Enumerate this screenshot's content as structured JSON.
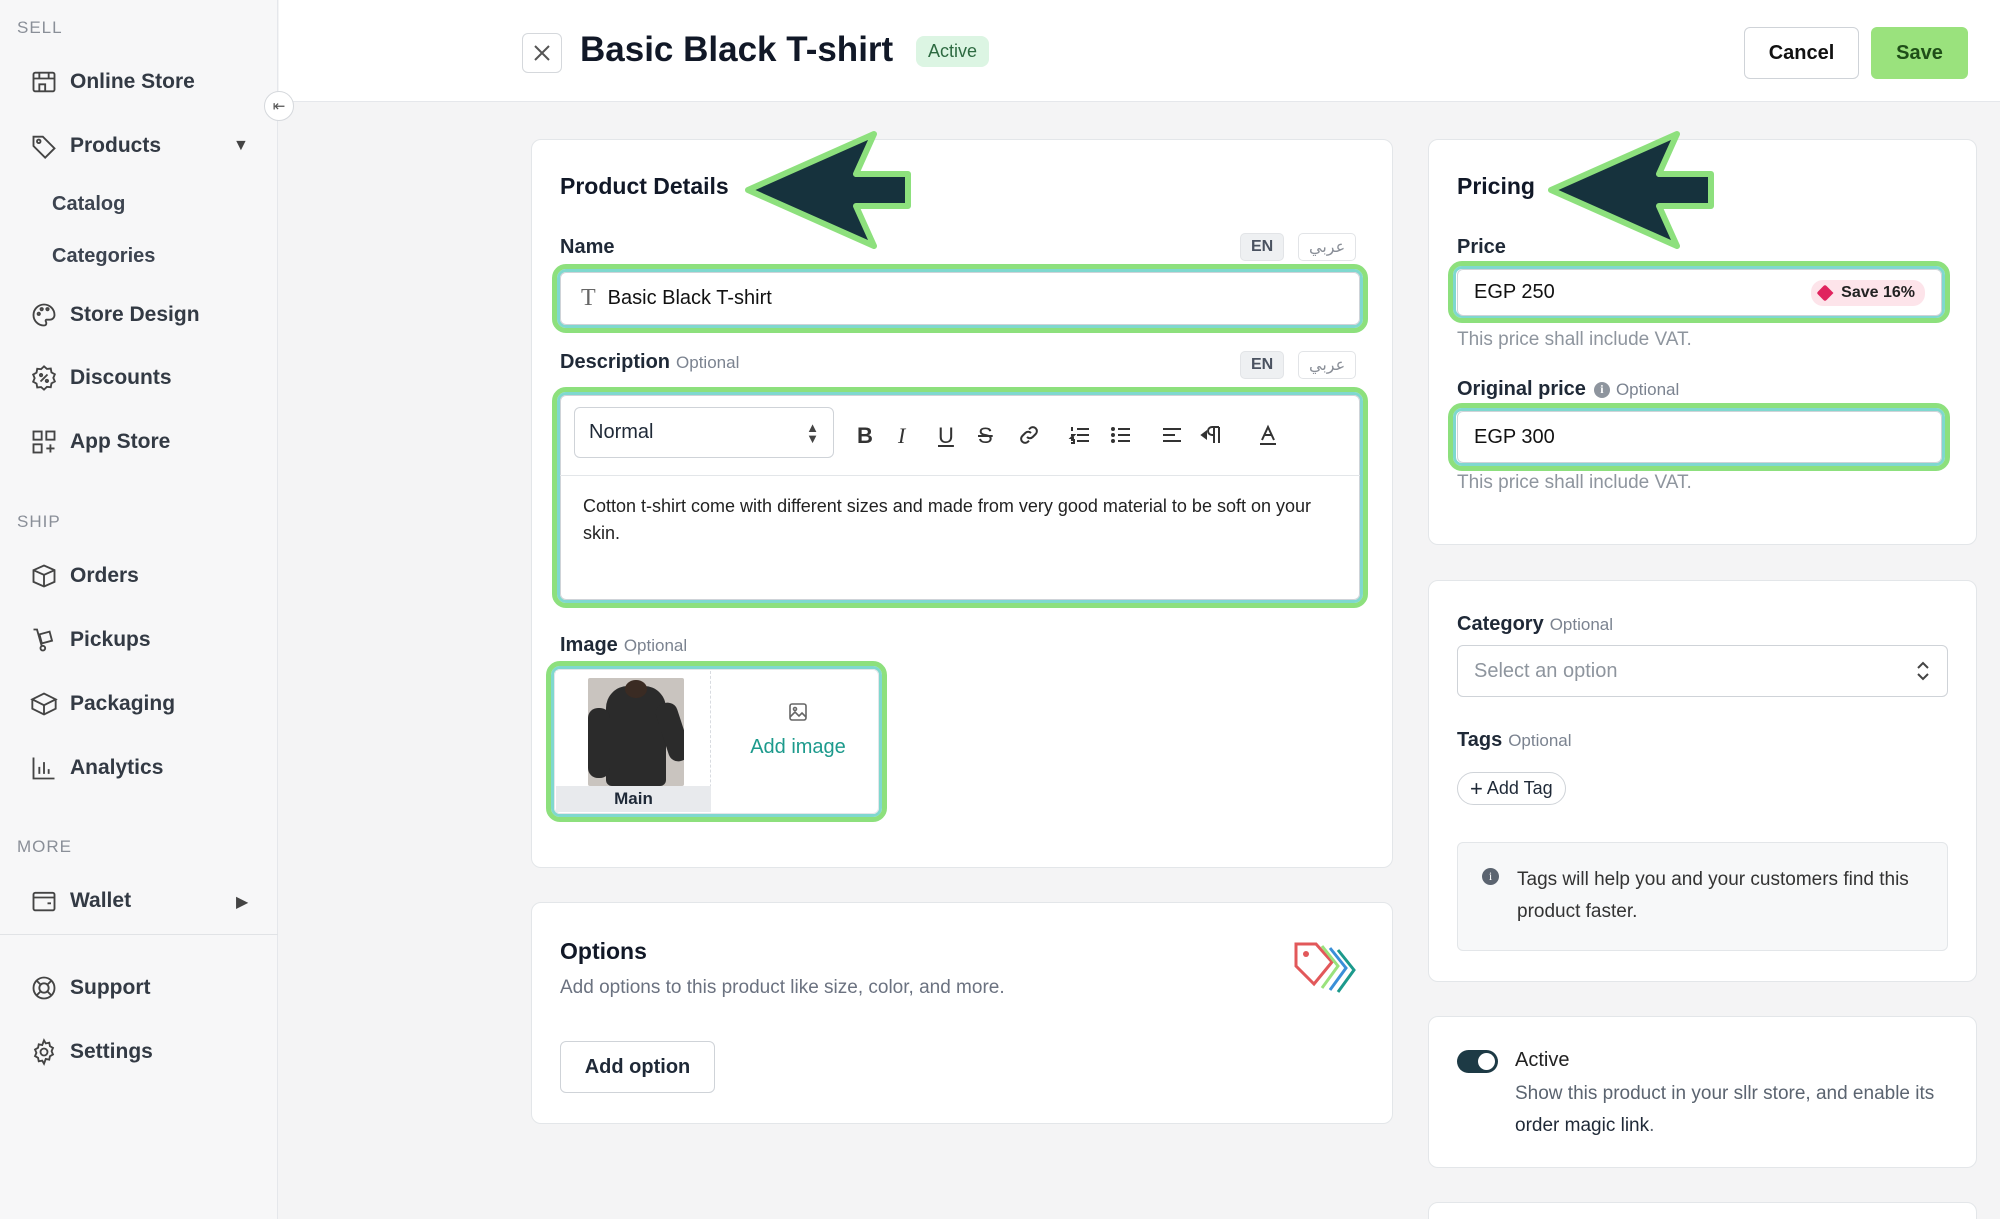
{
  "sidebar": {
    "sections": {
      "sell": "SELL",
      "ship": "SHIP",
      "more": "MORE"
    },
    "items": {
      "online_store": "Online Store",
      "products": "Products",
      "catalog": "Catalog",
      "categories": "Categories",
      "store_design": "Store Design",
      "discounts": "Discounts",
      "app_store": "App Store",
      "orders": "Orders",
      "pickups": "Pickups",
      "packaging": "Packaging",
      "analytics": "Analytics",
      "wallet": "Wallet",
      "support": "Support",
      "settings": "Settings"
    }
  },
  "header": {
    "title": "Basic Black T-shirt",
    "status": "Active",
    "cancel": "Cancel",
    "save": "Save"
  },
  "product_details": {
    "title": "Product Details",
    "name_label": "Name",
    "lang_en": "EN",
    "lang_ar": "عربي",
    "name_value": "Basic Black T-shirt",
    "description_label": "Description",
    "optional": "Optional",
    "format_select": "Normal",
    "description_text": "Cotton t-shirt come with different sizes and made from very good material to be soft on your skin.",
    "image_label": "Image",
    "image_main": "Main",
    "add_image": "Add image"
  },
  "options": {
    "title": "Options",
    "subtitle": "Add options to this product like size, color, and more.",
    "button": "Add option"
  },
  "pricing": {
    "title": "Pricing",
    "price_label": "Price",
    "price_value": "EGP 250",
    "save_badge": "Save 16%",
    "vat_hint": "This price shall include VAT.",
    "original_label": "Original price",
    "optional": "Optional",
    "original_value": "EGP 300"
  },
  "organize": {
    "category_label": "Category",
    "optional": "Optional",
    "category_placeholder": "Select an option",
    "tags_label": "Tags",
    "add_tag": "Add Tag",
    "tags_info": "Tags will help you and your customers find this product faster."
  },
  "status_card": {
    "toggle_label": "Active",
    "toggle_on": true,
    "desc_prefix": "Show this product in your sllr store, and enable its ",
    "desc_link": "order magic link",
    "desc_suffix": "."
  },
  "colors": {
    "accent_green": "#9ae27d",
    "highlight_green": "#8de07d",
    "highlight_teal": "#7fd8cf",
    "arrow_dark": "#16323d",
    "toggle_dark": "#1d3a45"
  }
}
